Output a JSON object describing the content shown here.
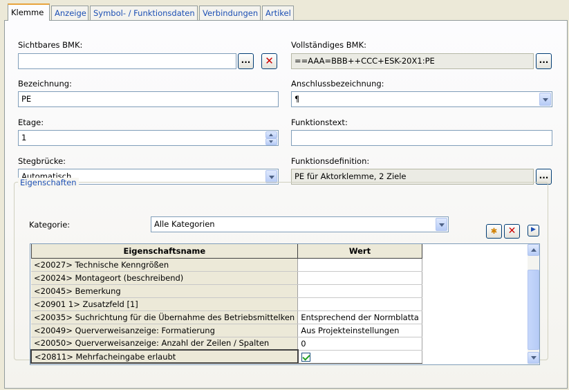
{
  "tabs": [
    {
      "label": "Klemme",
      "active": true
    },
    {
      "label": "Anzeige"
    },
    {
      "label": "Symbol- / Funktionsdaten"
    },
    {
      "label": "Verbindungen"
    },
    {
      "label": "Artikel"
    }
  ],
  "form": {
    "visible_bmk_label": "Sichtbares BMK:",
    "visible_bmk_value": "",
    "browse_label": "...",
    "full_bmk_label": "Vollständiges BMK:",
    "full_bmk_value": "==AAA=BBB++CCC+ESK-20X1:PE",
    "designation_label": "Bezeichnung:",
    "designation_value": "PE",
    "connection_label": "Anschlussbezeichnung:",
    "connection_value": "¶",
    "level_label": "Etage:",
    "level_value": "1",
    "function_text_label": "Funktionstext:",
    "function_text_value": "",
    "bridge_label": "Stegbrücke:",
    "bridge_value": "Automatisch",
    "function_def_label": "Funktionsdefinition:",
    "function_def_value": "PE für Aktorklemme, 2 Ziele"
  },
  "properties": {
    "group_label": "Eigenschaften",
    "category_label": "Kategorie:",
    "category_value": "Alle Kategorien",
    "columns": [
      "Eigenschaftsname",
      "Wert"
    ],
    "rows": [
      {
        "name": "<20027> Technische Kenngrößen",
        "value": ""
      },
      {
        "name": "<20024> Montageort (beschreibend)",
        "value": ""
      },
      {
        "name": "<20045> Bemerkung",
        "value": ""
      },
      {
        "name": "<20901 1> Zusatzfeld [1]",
        "value": ""
      },
      {
        "name": "<20035> Suchrichtung für die Übernahme des Betriebsmittelken",
        "value": "Entsprechend der Normblatta"
      },
      {
        "name": "<20049> Querverweisanzeige: Formatierung",
        "value": "Aus Projekteinstellungen"
      },
      {
        "name": "<20050> Querverweisanzeige: Anzahl der Zeilen / Spalten",
        "value": "0"
      },
      {
        "name": "<20811> Mehrfacheingabe erlaubt",
        "value": "",
        "checked": true
      }
    ]
  },
  "colors": {
    "accent": "#e8a33c",
    "link_blue": "#1c4fb4"
  }
}
